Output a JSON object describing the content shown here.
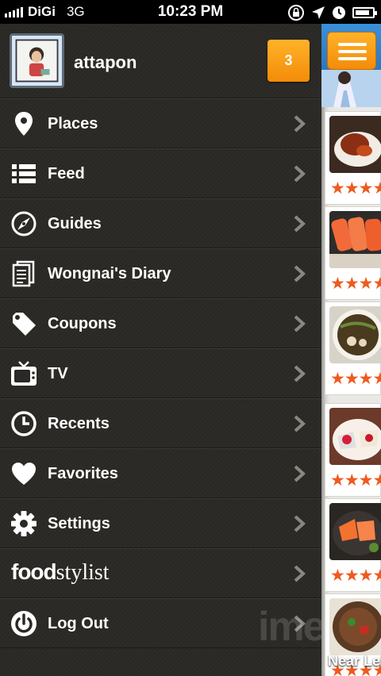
{
  "status_bar": {
    "carrier": "DiGi",
    "network": "3G",
    "time": "10:23 PM",
    "battery_level": 0.85
  },
  "profile": {
    "username": "attapon",
    "notification_count": "3"
  },
  "menu": {
    "items": [
      {
        "label": "Places",
        "icon": "map-pin-icon"
      },
      {
        "label": "Feed",
        "icon": "list-icon"
      },
      {
        "label": "Guides",
        "icon": "compass-icon"
      },
      {
        "label": "Wongnai's Diary",
        "icon": "document-icon"
      },
      {
        "label": "Coupons",
        "icon": "tag-icon"
      },
      {
        "label": "TV",
        "icon": "tv-icon"
      },
      {
        "label": "Recents",
        "icon": "clock-icon"
      },
      {
        "label": "Favorites",
        "icon": "heart-icon"
      },
      {
        "label": "Settings",
        "icon": "gear-icon"
      },
      {
        "label": "foodstylist",
        "icon": "foodstylist-logo"
      },
      {
        "label": "Log Out",
        "icon": "power-icon"
      }
    ]
  },
  "content": {
    "ratings": [
      "★★★★",
      "★★★★",
      "★★★★",
      "★★★★",
      "★★★★",
      "★★★★"
    ],
    "near_label": "Near Le"
  },
  "colors": {
    "drawer_bg": "#2b2925",
    "accent_orange": "#f7a01a",
    "star_color": "#ef5a1e"
  }
}
